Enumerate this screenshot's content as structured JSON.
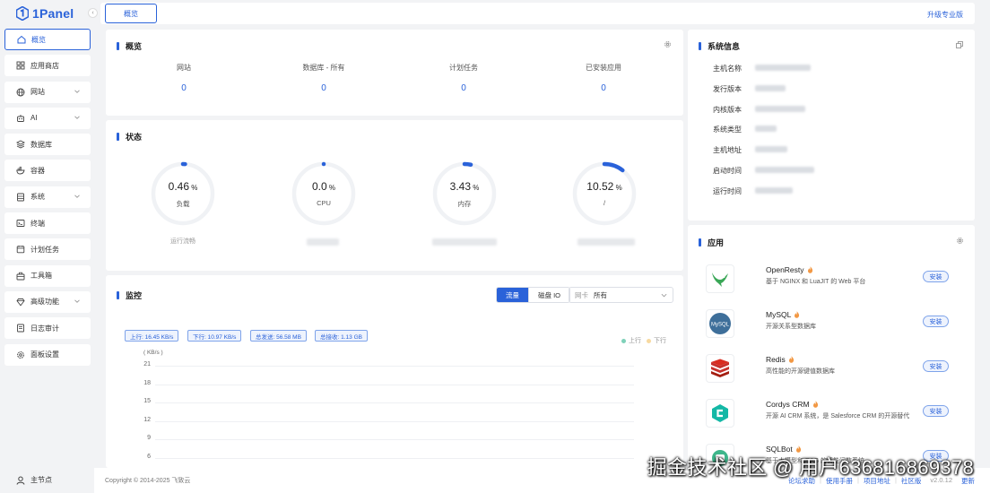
{
  "brand": {
    "name": "1Panel",
    "collapse_glyph": "‹"
  },
  "sidebar": {
    "items": [
      {
        "label": "概览",
        "icon": "home-icon",
        "active": true,
        "expandable": false
      },
      {
        "label": "应用商店",
        "icon": "grid-icon",
        "active": false,
        "expandable": false
      },
      {
        "label": "网站",
        "icon": "globe-icon",
        "active": false,
        "expandable": true
      },
      {
        "label": "AI",
        "icon": "robot-icon",
        "active": false,
        "expandable": true
      },
      {
        "label": "数据库",
        "icon": "layers-icon",
        "active": false,
        "expandable": false
      },
      {
        "label": "容器",
        "icon": "docker-icon",
        "active": false,
        "expandable": false
      },
      {
        "label": "系统",
        "icon": "server-icon",
        "active": false,
        "expandable": true
      },
      {
        "label": "终端",
        "icon": "terminal-icon",
        "active": false,
        "expandable": false
      },
      {
        "label": "计划任务",
        "icon": "calendar-icon",
        "active": false,
        "expandable": false
      },
      {
        "label": "工具箱",
        "icon": "toolbox-icon",
        "active": false,
        "expandable": false
      },
      {
        "label": "高级功能",
        "icon": "diamond-icon",
        "active": false,
        "expandable": true
      },
      {
        "label": "日志审计",
        "icon": "log-icon",
        "active": false,
        "expandable": false
      },
      {
        "label": "面板设置",
        "icon": "settings-icon",
        "active": false,
        "expandable": false
      }
    ],
    "node_label": "主节点"
  },
  "topbar": {
    "tab": "概览",
    "upgrade": "升级专业版"
  },
  "overview": {
    "title": "概览",
    "stats": [
      {
        "label": "网站",
        "value": "0"
      },
      {
        "label": "数据库 - 所有",
        "value": "0"
      },
      {
        "label": "计划任务",
        "value": "0"
      },
      {
        "label": "已安装应用",
        "value": "0"
      }
    ]
  },
  "status": {
    "title": "状态",
    "gauges": [
      {
        "int": "0.",
        "dec": "46",
        "unit": " %",
        "label": "负载",
        "percent": 0.46,
        "sub": "运行流畅"
      },
      {
        "int": "0.",
        "dec": "0",
        "unit": " %",
        "label": "CPU",
        "percent": 0.0,
        "sub": ""
      },
      {
        "int": "3.",
        "dec": "43",
        "unit": " %",
        "label": "内存",
        "percent": 3.43,
        "sub": ""
      },
      {
        "int": "10.",
        "dec": "52",
        "unit": " %",
        "label": "/",
        "percent": 10.52,
        "sub": ""
      }
    ],
    "accent": "#2a62d9",
    "track": "#f0f2f5"
  },
  "monitor": {
    "title": "监控",
    "tabs": [
      "流量",
      "磁盘 IO"
    ],
    "active_tab": "流量",
    "netcard_label": "网卡",
    "netcard_value": "所有",
    "pills": [
      "上行: 16.45 KB/s",
      "下行: 10.97 KB/s",
      "总发送: 56.58 MB",
      "总接收: 1.13 GB"
    ],
    "legend": [
      {
        "name": "上行",
        "color": "#7fd1b9"
      },
      {
        "name": "下行",
        "color": "#f7d9a0"
      }
    ],
    "y_unit": "( KB/s )",
    "y_ticks": [
      "21",
      "18",
      "15",
      "12",
      "9",
      "6"
    ]
  },
  "sysinfo": {
    "title": "系统信息",
    "rows": [
      "主机名称",
      "发行版本",
      "内核版本",
      "系统类型",
      "主机地址",
      "启动时间",
      "运行时间"
    ]
  },
  "apps": {
    "title": "应用",
    "install_label": "安装",
    "list": [
      {
        "name": "OpenResty",
        "desc": "基于 NGINX 和 LuaJIT 的 Web 平台",
        "logo": "openresty-logo"
      },
      {
        "name": "MySQL",
        "desc": "开源关系型数据库",
        "logo": "mysql-logo"
      },
      {
        "name": "Redis",
        "desc": "高性能的开源键值数据库",
        "logo": "redis-logo"
      },
      {
        "name": "Cordys CRM",
        "desc": "开源 AI CRM 系统，是 Salesforce CRM 的开源替代",
        "logo": "cordys-logo"
      },
      {
        "name": "SQLBot",
        "desc": "基于大模型和 RAG 的智能问数系统",
        "logo": "sqlbot-logo"
      }
    ]
  },
  "footer": {
    "copyright": "Copyright © 2014-2025 飞致云",
    "links": [
      "论坛求助",
      "使用手册",
      "项目地址",
      "社区版"
    ],
    "version": "v2.0.12",
    "update": "更新"
  },
  "watermark": "掘金技术社区 @ 用户6368168​69378"
}
